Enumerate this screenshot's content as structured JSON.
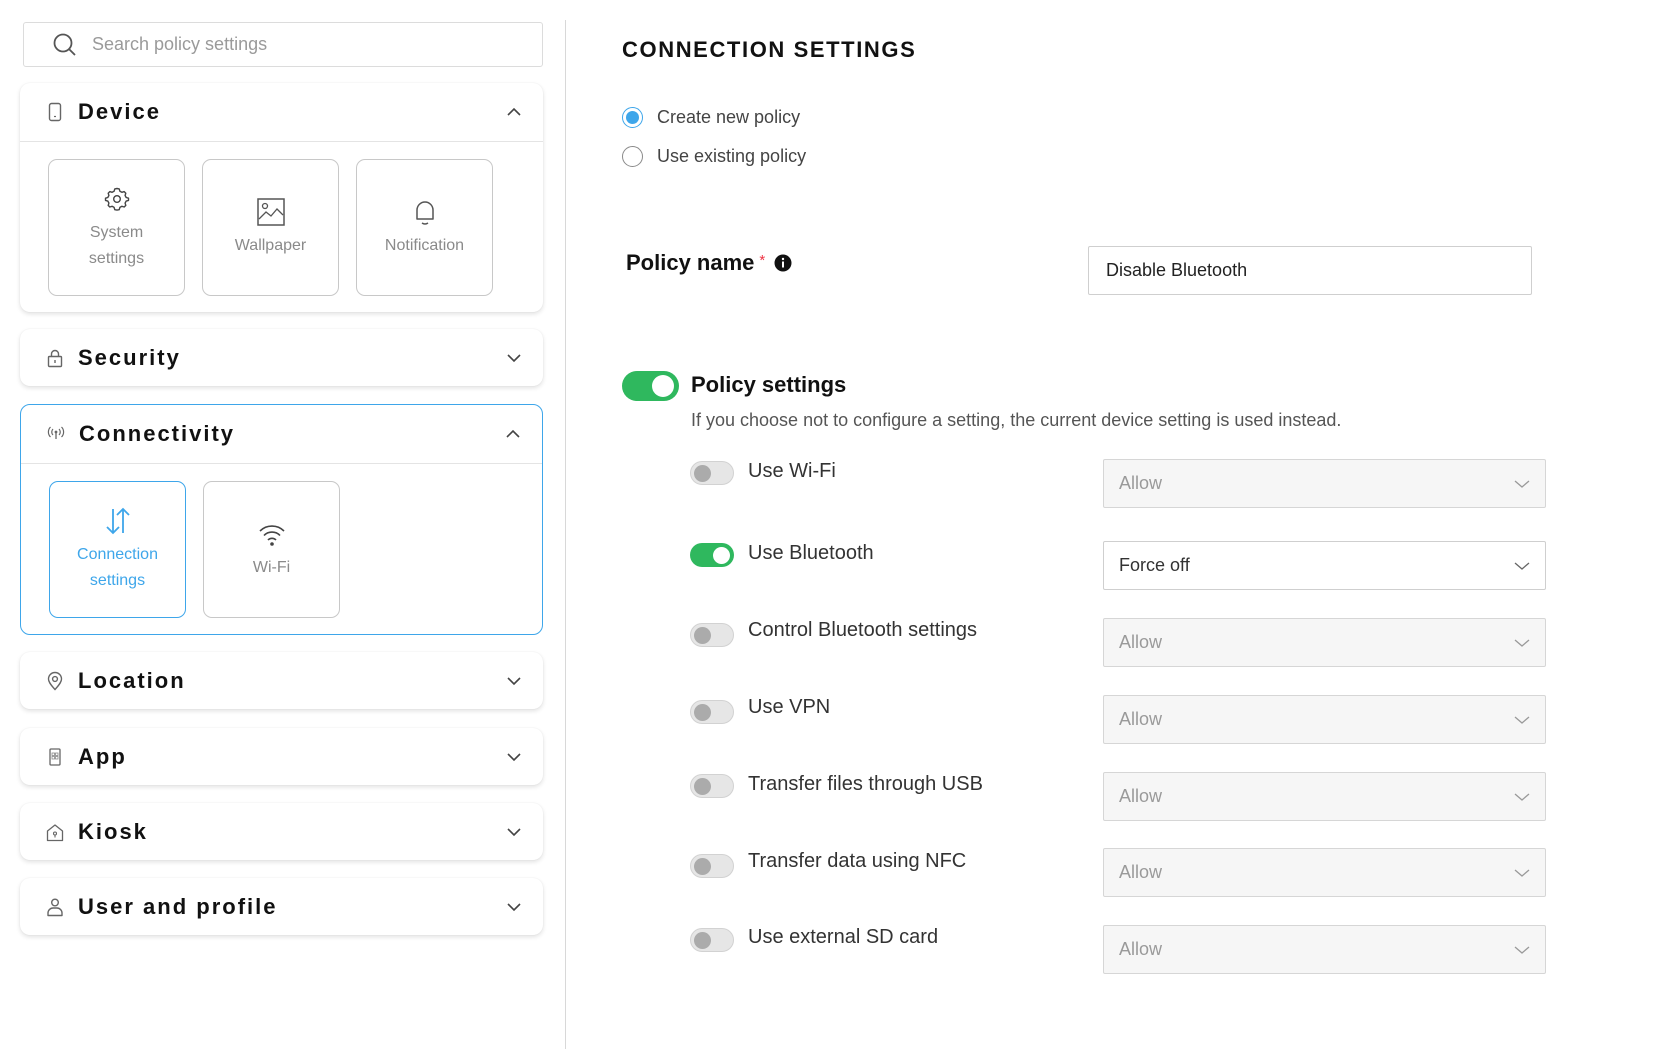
{
  "search": {
    "placeholder": "Search policy settings",
    "icon": "search-icon"
  },
  "categories": [
    {
      "title": "Device",
      "icon": "phone-icon",
      "expanded": true,
      "items": [
        {
          "label_line1": "System",
          "label_line2": "settings",
          "icon": "gear-icon"
        },
        {
          "label_line1": "Wallpaper",
          "label_line2": "",
          "icon": "image-icon"
        },
        {
          "label_line1": "Notification",
          "label_line2": "",
          "icon": "bell-icon"
        }
      ]
    },
    {
      "title": "Security",
      "icon": "lock-icon",
      "expanded": false
    },
    {
      "title": "Connectivity",
      "icon": "antenna-icon",
      "expanded": true,
      "active": true,
      "items": [
        {
          "label_line1": "Connection",
          "label_line2": "settings",
          "icon": "transfer-arrows-icon",
          "selected": true
        },
        {
          "label_line1": "Wi-Fi",
          "label_line2": "",
          "icon": "wifi-icon"
        }
      ]
    },
    {
      "title": "Location",
      "icon": "location-pin-icon",
      "expanded": false
    },
    {
      "title": "App",
      "icon": "app-icon",
      "expanded": false
    },
    {
      "title": "Kiosk",
      "icon": "kiosk-icon",
      "expanded": false
    },
    {
      "title": "User and profile",
      "icon": "user-icon",
      "expanded": false
    }
  ],
  "main": {
    "title": "CONNECTION SETTINGS",
    "policy_mode": {
      "options": [
        "Create new policy",
        "Use existing policy"
      ],
      "selected": "Create new policy"
    },
    "policy_name": {
      "label": "Policy name",
      "required_mark": "*",
      "value": "Disable Bluetooth"
    },
    "policy_settings": {
      "title": "Policy settings",
      "enabled": true,
      "description": "If you choose not to configure a setting, the current device setting is used instead.",
      "settings": [
        {
          "label": "Use Wi-Fi",
          "enabled": false,
          "value": "Allow"
        },
        {
          "label": "Use Bluetooth",
          "enabled": true,
          "value": "Force off"
        },
        {
          "label": "Control Bluetooth settings",
          "enabled": false,
          "value": "Allow"
        },
        {
          "label": "Use VPN",
          "enabled": false,
          "value": "Allow"
        },
        {
          "label": "Transfer files through USB",
          "enabled": false,
          "value": "Allow"
        },
        {
          "label": "Transfer data using NFC",
          "enabled": false,
          "value": "Allow"
        },
        {
          "label": "Use external SD card",
          "enabled": false,
          "value": "Allow"
        }
      ]
    }
  },
  "colors": {
    "accent": "#3ea6ea",
    "toggle_on": "#2fb85e",
    "required": "#ee3344"
  }
}
